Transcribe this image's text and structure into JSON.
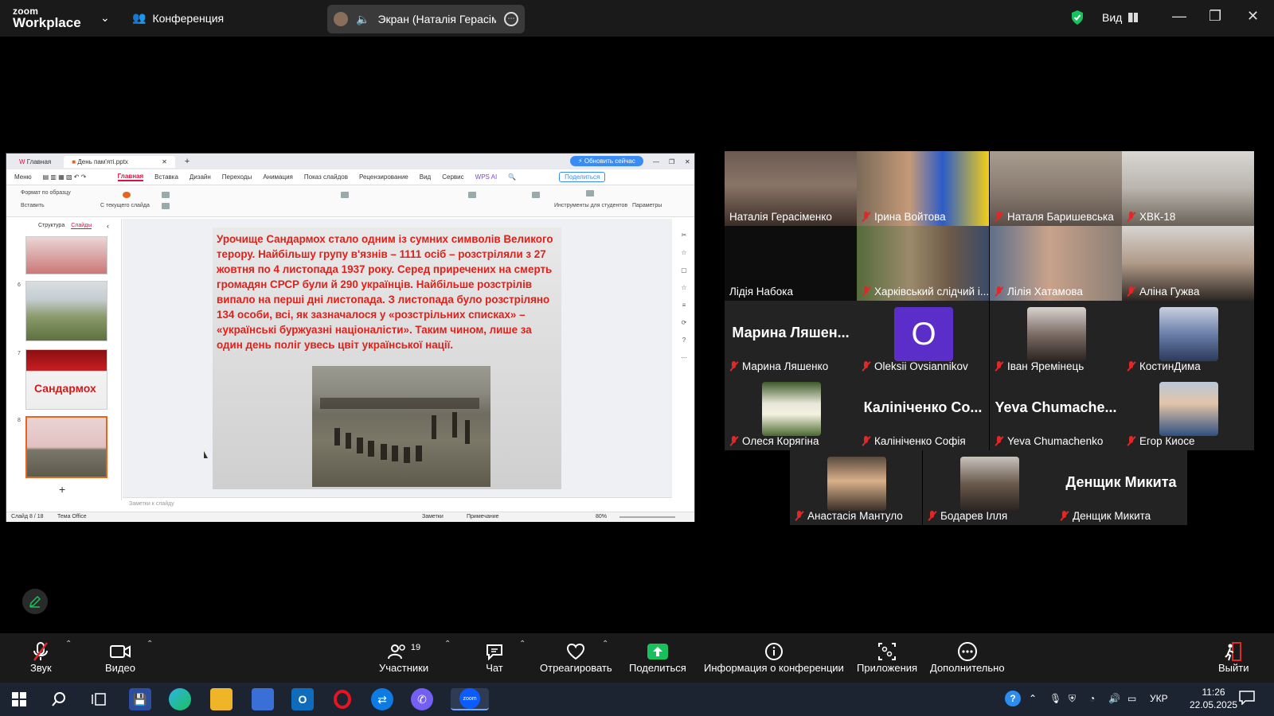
{
  "app": {
    "logo_top": "zoom",
    "logo_bottom": "Workplace",
    "meeting_button": "Конференция",
    "share_label": "Экран (Наталія Герасіменк",
    "view_label": "Вид",
    "colors": {
      "speaking": "#2ed97c",
      "muted": "#e02828",
      "share_green": "#19c15c"
    }
  },
  "shared": {
    "tabs": [
      "Главная",
      "День пам'яті.pptx"
    ],
    "update_button": "Обновить сейчас",
    "share_doc_btn": "Поделиться",
    "menu": [
      "Меню",
      "Главная",
      "Вставка",
      "Дизайн",
      "Переходы",
      "Анимация",
      "Показ слайдов",
      "Рецензирование",
      "Вид",
      "Сервис",
      "WPS AI"
    ],
    "ribbon": {
      "format_painter": "Формат по образцу",
      "paste": "Вставить",
      "from_current": "С текущего слайда",
      "student_tools": "Инструменты для студентов",
      "params": "Параметры"
    },
    "panel_tabs": [
      "Структура",
      "Слайды"
    ],
    "thumb_nums": [
      "6",
      "7",
      "8"
    ],
    "thumb7_title": "Сандармох",
    "slide_text": "Урочище Сандармох стало одним із сумних символів Великого терору. Найбільшу групу в'язнів – 1111 осіб – розстріляли з 27 жовтня по 4 листопада 1937 року. Серед приречених на смерть громадян СРСР були й 290 українців. Найбільше розстрілів випало на перші дні листопада. З листопада було розстріляно 134 особи, всі, як зазначалося у «розстрільних списках» – «українські буржуазні націоналісти». Таким чином, лише за один день поліг увесь цвіт української нації.",
    "notes": "Заметки к слайду",
    "status_left": "Слайд 8 / 18",
    "status_theme": "Тема Office",
    "status_notes": "Заметки",
    "status_comment": "Примечание",
    "zoom": "80%"
  },
  "participants": [
    {
      "name": "Наталія Герасіменко",
      "muted": false,
      "speaking": true
    },
    {
      "name": "Ірина Войтова",
      "muted": true
    },
    {
      "name": "Наталя Баришевська",
      "muted": true
    },
    {
      "name": "ХВК-18",
      "muted": true
    },
    {
      "name": "Лідія Набока",
      "muted": false
    },
    {
      "name": "Харківський слідчий і...",
      "muted": true
    },
    {
      "name": "Лілія Хатамова",
      "muted": true
    },
    {
      "name": "Аліна Гужва",
      "muted": true
    },
    {
      "name": "Марина Ляшенко",
      "muted": true,
      "big": "Марина Ляшен..."
    },
    {
      "name": "Oleksii Ovsiannikov",
      "muted": true,
      "letter": "O"
    },
    {
      "name": "Іван Яремінець",
      "muted": true
    },
    {
      "name": "КостинДима",
      "muted": true
    },
    {
      "name": "Олеся Корягіна",
      "muted": true
    },
    {
      "name": "Калініченко Софія",
      "muted": true,
      "big": "Каліniченко Со..."
    },
    {
      "name": "Yeva Chumachenko",
      "muted": true,
      "big": "Yeva Chumache..."
    },
    {
      "name": "Егор Киосе",
      "muted": true
    },
    {
      "name": "Анастасія Мантуло",
      "muted": true
    },
    {
      "name": "Бодарев Ілля",
      "muted": true
    },
    {
      "name": "Денщик Микита",
      "muted": true,
      "big": "Денщик Микита"
    }
  ],
  "toolbar": {
    "audio": "Звук",
    "video": "Видео",
    "participants": "Участники",
    "participants_count": "19",
    "chat": "Чат",
    "react": "Отреагировать",
    "share": "Поделиться",
    "info": "Информация о конференции",
    "apps": "Приложения",
    "more": "Дополнительно",
    "leave": "Выйти"
  },
  "taskbar": {
    "lang": "УКР",
    "time": "11:26",
    "date": "22.05.2025"
  }
}
